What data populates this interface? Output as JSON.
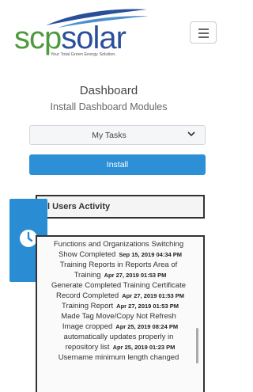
{
  "brand": {
    "logo_scp": "scp",
    "logo_solar": "solar",
    "tagline": "Your Total Green Energy Solution.",
    "colors": {
      "green": "#4e9a3e",
      "blue": "#2a4f9a",
      "accent": "#2d8fd6"
    }
  },
  "header": {
    "menu_icon": "hamburger-icon"
  },
  "page": {
    "title": "Dashboard",
    "subtitle": "Install Dashboard Modules"
  },
  "module_select": {
    "value": "My Tasks"
  },
  "install_label": "Install",
  "activity": {
    "heading": "ll Users Activity",
    "items": [
      {
        "text": "Functions and Organizations Switching",
        "date": ""
      },
      {
        "text": "Show Completed",
        "date": "Sep 15, 2019 04:34 PM"
      },
      {
        "text": "Training Reports in Reports Area of",
        "date": ""
      },
      {
        "text": "Training",
        "date": "Apr 27, 2019 01:53 PM"
      },
      {
        "text": "Generate Completed Training Certificate",
        "date": ""
      },
      {
        "text": "Record Completed",
        "date": "Apr 27, 2019 01:53 PM"
      },
      {
        "text": "Training Report",
        "date": "Apr 27, 2019 01:53 PM"
      },
      {
        "text": "Made Tag Move/Copy Not Refresh",
        "date": ""
      },
      {
        "text": "Image cropped",
        "date": "Apr 25, 2019 08:24 PM"
      },
      {
        "text": "automatically updates properly in",
        "date": ""
      },
      {
        "text": "repository list",
        "date": "Apr 25, 2019 01:23 PM"
      },
      {
        "text": "Username minimum length changed",
        "date": ""
      }
    ]
  }
}
